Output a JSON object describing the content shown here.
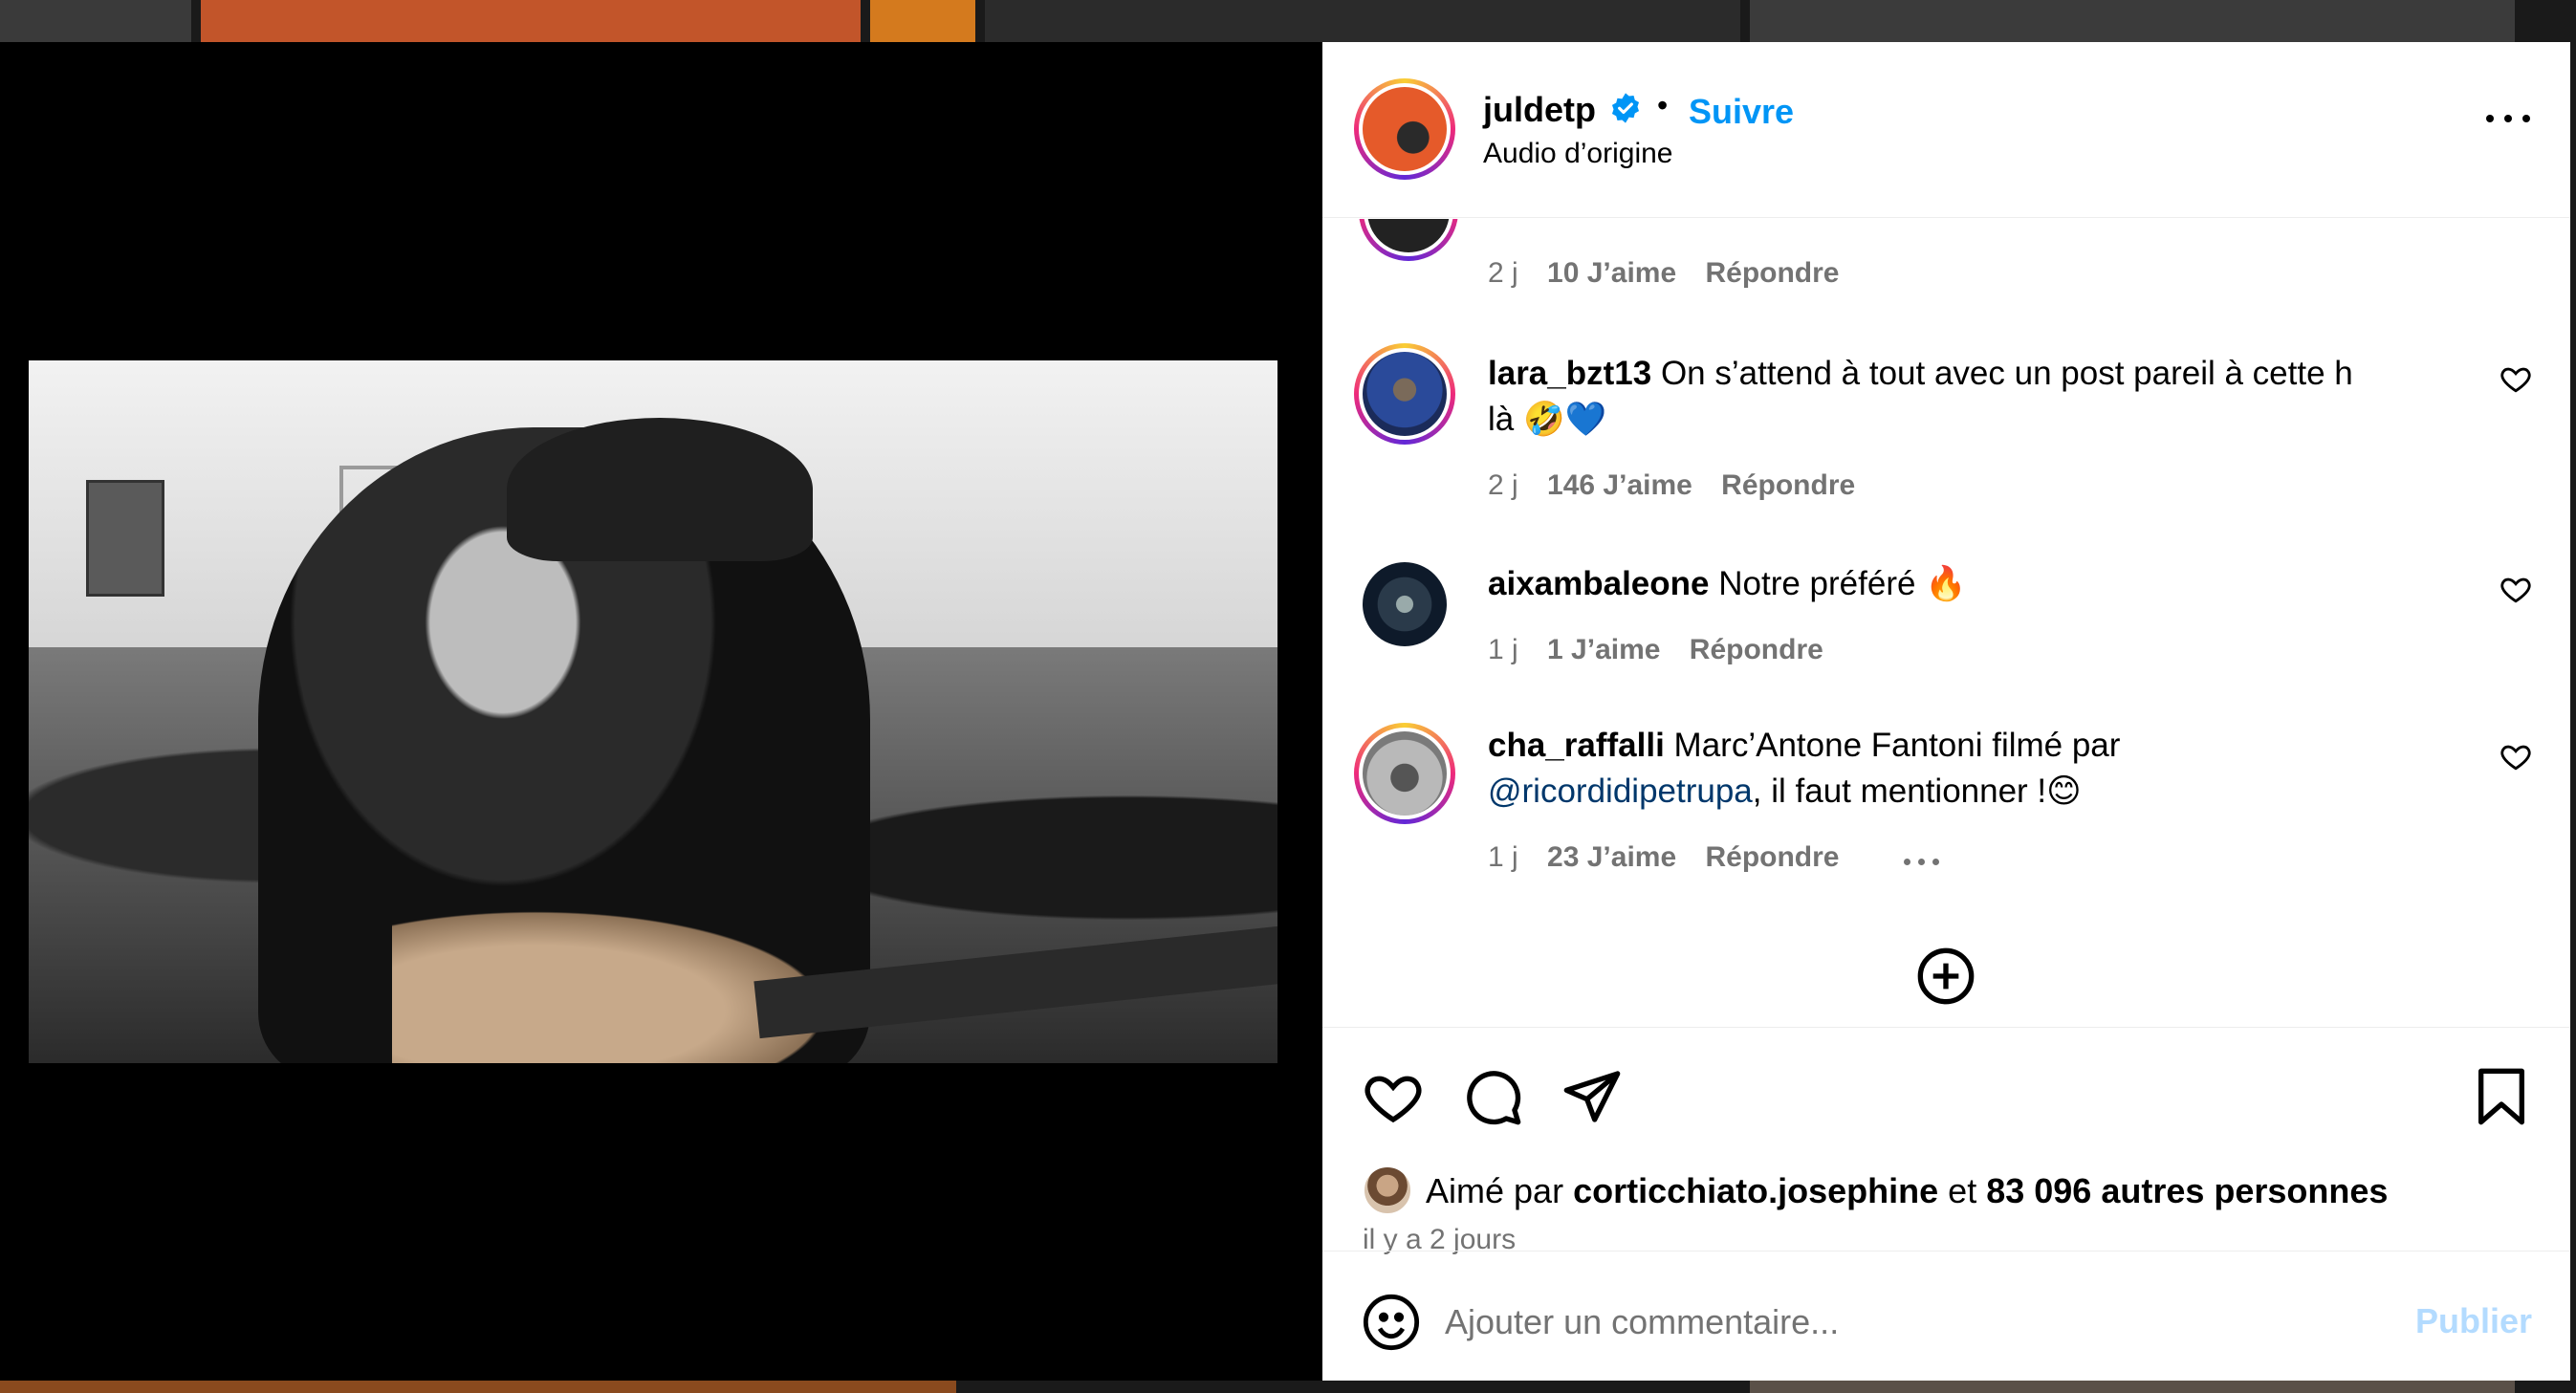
{
  "post": {
    "username": "juldetp",
    "follow_label": "Suivre",
    "separator": "•",
    "audio": "Audio d’origine"
  },
  "prev_comment": {
    "age": "2 j",
    "likes": "10 J’aime",
    "reply": "Répondre"
  },
  "comments": [
    {
      "username": "lara_bzt13",
      "text": "On s’attend à tout avec un post pareil à cette h",
      "text2": "là 🤣💙",
      "age": "2 j",
      "likes": "146 J’aime",
      "reply": "Répondre"
    },
    {
      "username": "aixambaleone",
      "text": "Notre préféré 🔥",
      "age": "1 j",
      "likes": "1 J’aime",
      "reply": "Répondre"
    },
    {
      "username": "cha_raffalli",
      "text": "Marc’Antone Fantoni filmé par",
      "mention": "@ricordidipetrupa",
      "text2": ", il faut mentionner !😊",
      "age": "1 j",
      "likes": "23 J’aime",
      "reply": "Répondre"
    }
  ],
  "likes_line": {
    "prefix": "Aimé par",
    "user": "corticchiato.josephine",
    "and": "et",
    "count": "83 096 autres personnes"
  },
  "posted_ago": "il y a 2 jours",
  "composer": {
    "placeholder": "Ajouter un commentaire...",
    "publish_label": "Publier"
  },
  "icons": [
    "verified-badge-icon",
    "more-icon",
    "heart-icon",
    "comment-icon",
    "share-icon",
    "bookmark-icon",
    "add-circle-icon",
    "emoji-icon",
    "mute-icon"
  ],
  "colors": {
    "accent": "#0095f6",
    "muted": "#737373",
    "publish_disabled": "#b3dbff"
  }
}
